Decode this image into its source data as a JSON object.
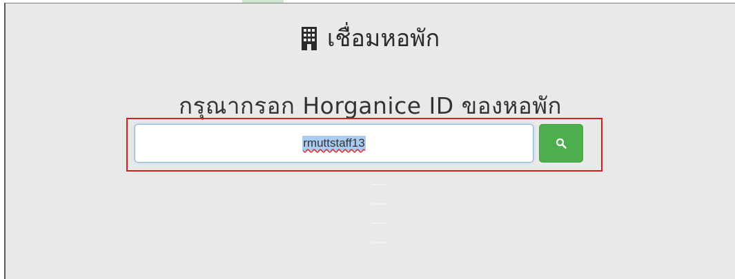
{
  "header": {
    "title": "เชื่อมหอพัก",
    "title_icon": "building-icon"
  },
  "form": {
    "prompt": "กรุณากรอก Horganice ID ของหอพัก",
    "search_value": "rmuttstaff13",
    "search_button_icon": "search-icon"
  },
  "colors": {
    "background": "#e9e9e9",
    "accent_green": "#4cae4c",
    "highlight_red": "#d21f1f"
  }
}
